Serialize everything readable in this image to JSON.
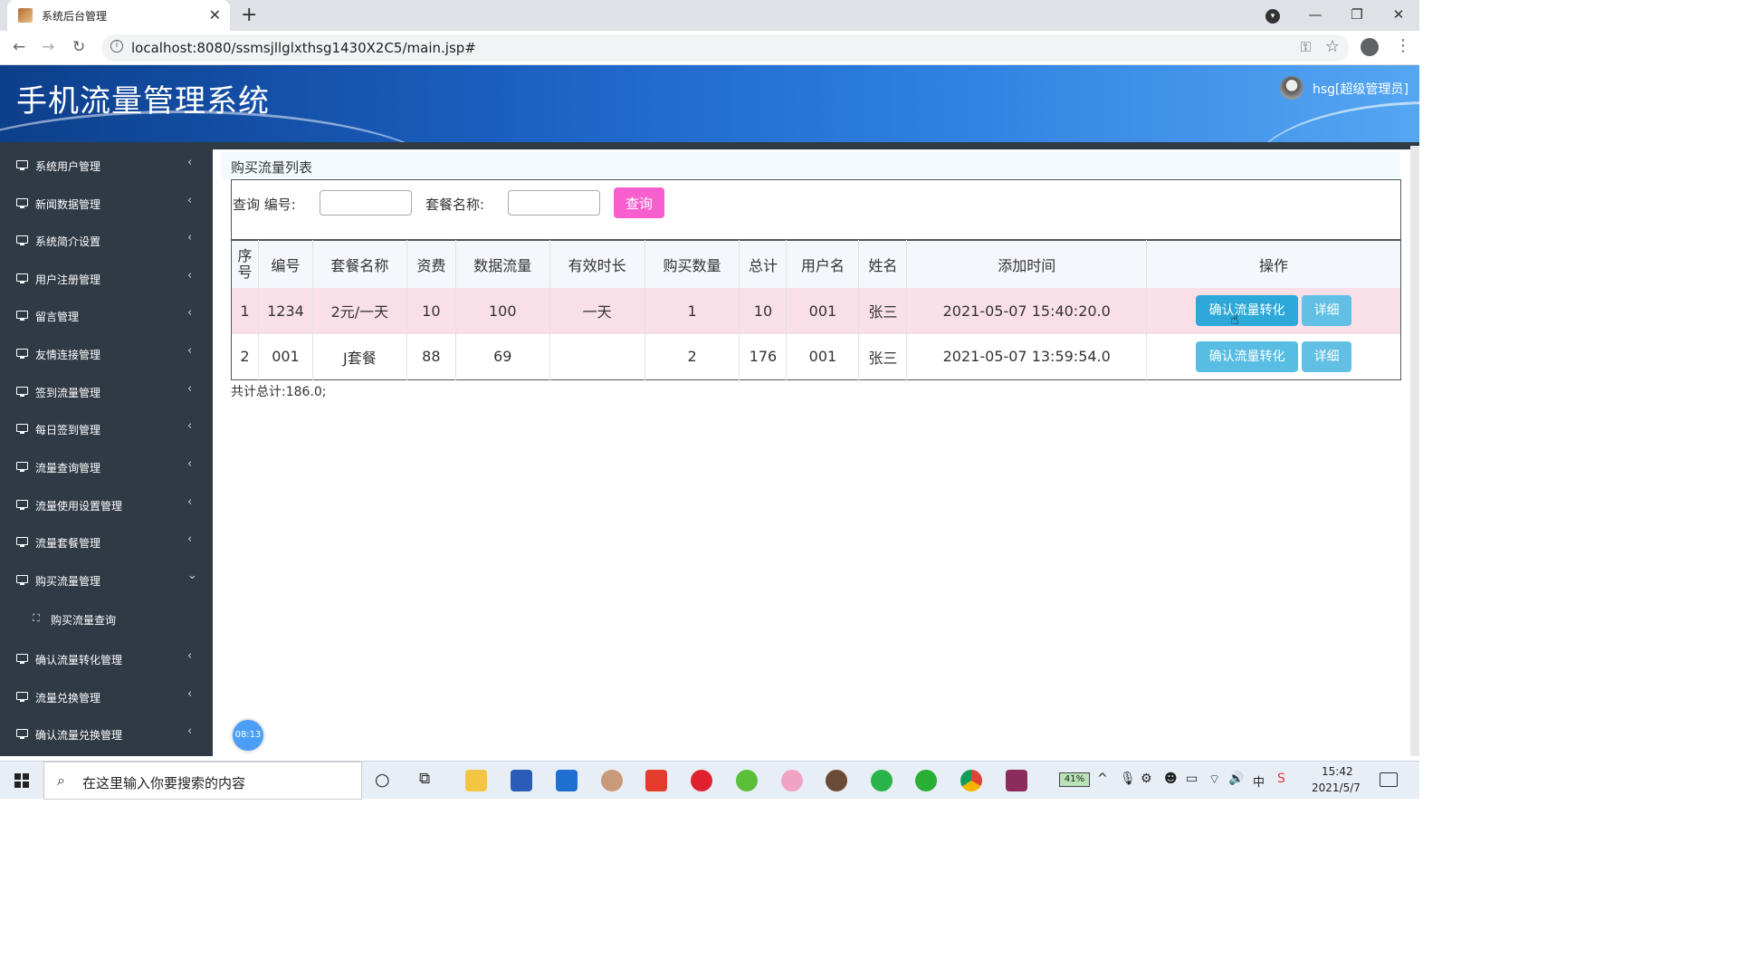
{
  "browser": {
    "tab_title": "系统后台管理",
    "url": "localhost:8080/ssmsjllglxthsg1430X2C5/main.jsp#"
  },
  "header": {
    "app_title": "手机流量管理系统",
    "user": "hsg[超级管理员]"
  },
  "sidebar": {
    "items": [
      {
        "label": "系统用户管理"
      },
      {
        "label": "新闻数据管理"
      },
      {
        "label": "系统简介设置"
      },
      {
        "label": "用户注册管理"
      },
      {
        "label": "留言管理"
      },
      {
        "label": "友情连接管理"
      },
      {
        "label": "签到流量管理"
      },
      {
        "label": "每日签到管理"
      },
      {
        "label": "流量查询管理"
      },
      {
        "label": "流量使用设置管理"
      },
      {
        "label": "流量套餐管理"
      },
      {
        "label": "购买流量管理"
      },
      {
        "label": "确认流量转化管理"
      },
      {
        "label": "流量兑换管理"
      },
      {
        "label": "确认流量兑换管理"
      }
    ],
    "sub_item": "购买流量查询"
  },
  "main": {
    "panel_title": "购买流量列表",
    "search": {
      "query_label": "查询 编号:",
      "package_label": "套餐名称:",
      "button": "查询"
    },
    "table": {
      "headers": [
        "序号",
        "编号",
        "套餐名称",
        "资费",
        "数据流量",
        "有效时长",
        "购买数量",
        "总计",
        "用户名",
        "姓名",
        "添加时间",
        "操作"
      ],
      "rows": [
        [
          "1",
          "1234",
          "2元/一天",
          "10",
          "100",
          "一天",
          "1",
          "10",
          "001",
          "张三",
          "2021-05-07 15:40:20.0"
        ],
        [
          "2",
          "001",
          "J套餐",
          "88",
          "69",
          "",
          "2",
          "176",
          "001",
          "张三",
          "2021-05-07 13:59:54.0"
        ]
      ],
      "confirm_button": "确认流量转化",
      "detail_button": "详细"
    },
    "total": "共计总计:186.0;",
    "clock_bubble": "08:13"
  },
  "taskbar": {
    "search_placeholder": "在这里输入你要搜索的内容",
    "battery": "41%",
    "ime": "中",
    "time": "15:42",
    "date": "2021/5/7"
  }
}
